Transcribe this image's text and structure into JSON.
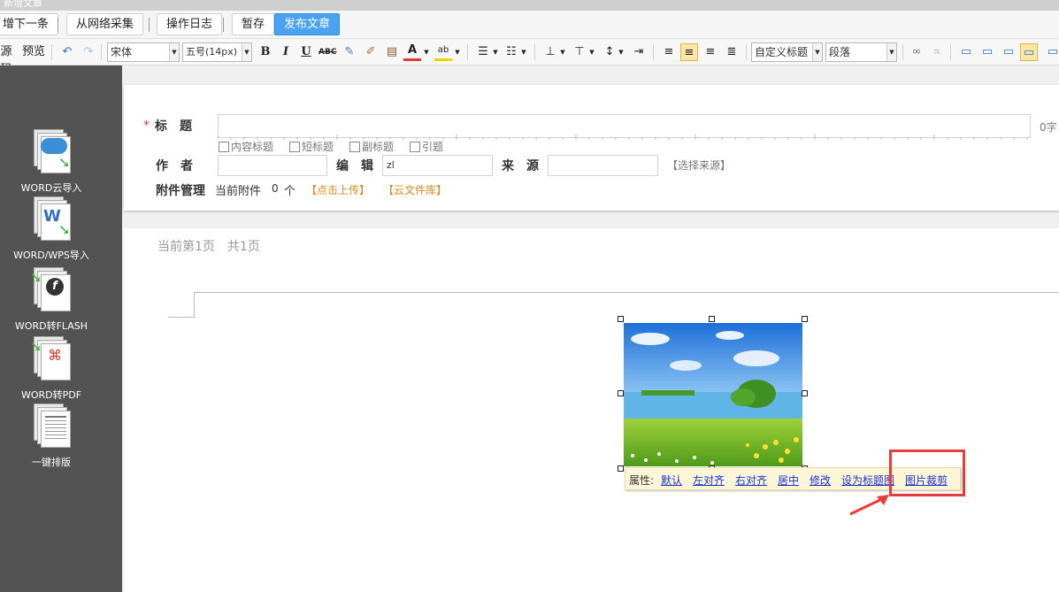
{
  "window": {
    "title": "新增文章"
  },
  "topbar": {
    "save_next": "增下一条",
    "collect": "从网络采集",
    "log": "操作日志",
    "draft": "暂存",
    "publish": "发布文章"
  },
  "editor_toolbar": {
    "source": "源码",
    "preview": "预览",
    "font_family": "宋体",
    "font_size": "五号(14px)",
    "heading": "自定义标题",
    "paragraph": "段落",
    "icons": [
      "undo-icon",
      "redo-icon",
      "bold-icon",
      "italic-icon",
      "underline-icon",
      "strikethrough-icon",
      "format-brush-icon",
      "clear-format-icon",
      "paste-icon",
      "font-color-icon",
      "highlight-icon",
      "ordered-list-icon",
      "unordered-list-icon",
      "align-top-icon",
      "align-middle-icon",
      "line-height-icon",
      "indent-icon",
      "align-left-icon",
      "align-center-icon",
      "align-right-icon",
      "justify-icon",
      "link-icon",
      "unlink-icon",
      "image-default-icon",
      "image-left-icon",
      "image-right-icon",
      "image-center-icon",
      "more-icon"
    ],
    "accent_colors": {
      "font_color": "#e53935",
      "highlight": "#f5d000",
      "active": "#fde7a6"
    }
  },
  "sidebar": {
    "items": [
      {
        "label": "WORD云导入",
        "icon": "word-cloud-import-icon"
      },
      {
        "label": "WORD/WPS导入",
        "icon": "word-wps-import-icon"
      },
      {
        "label": "WORD转FLASH",
        "icon": "word-to-flash-icon"
      },
      {
        "label": "WORD转PDF",
        "icon": "word-to-pdf-icon"
      },
      {
        "label": "一键排版",
        "icon": "auto-layout-icon"
      }
    ]
  },
  "form": {
    "required_mark": "*",
    "title_label": "标　题",
    "title_value": "",
    "title_count": "0字",
    "checkboxes": [
      "内容标题",
      "短标题",
      "副标题",
      "引题"
    ],
    "author_label": "作　者",
    "author_value": "",
    "editor_label": "编　辑",
    "editor_value": "zl",
    "source_label": "来　源",
    "source_value": "",
    "source_select": "【选择来源】",
    "attach_label": "附件管理",
    "attach_current": "当前附件",
    "attach_count": "0",
    "attach_unit": "个",
    "upload": "【点击上传】",
    "cloud_lib": "【云文件库】"
  },
  "content": {
    "page_info": "当前第1页　共1页",
    "image_alt": "landscape-image"
  },
  "image_popup": {
    "label": "属性:",
    "default": "默认",
    "left": "左对齐",
    "right": "右对齐",
    "center": "居中",
    "edit": "修改",
    "set_title": "设为标题图",
    "crop": "图片裁剪"
  },
  "annotation": {
    "highlight_color": "#ea3b3b"
  }
}
